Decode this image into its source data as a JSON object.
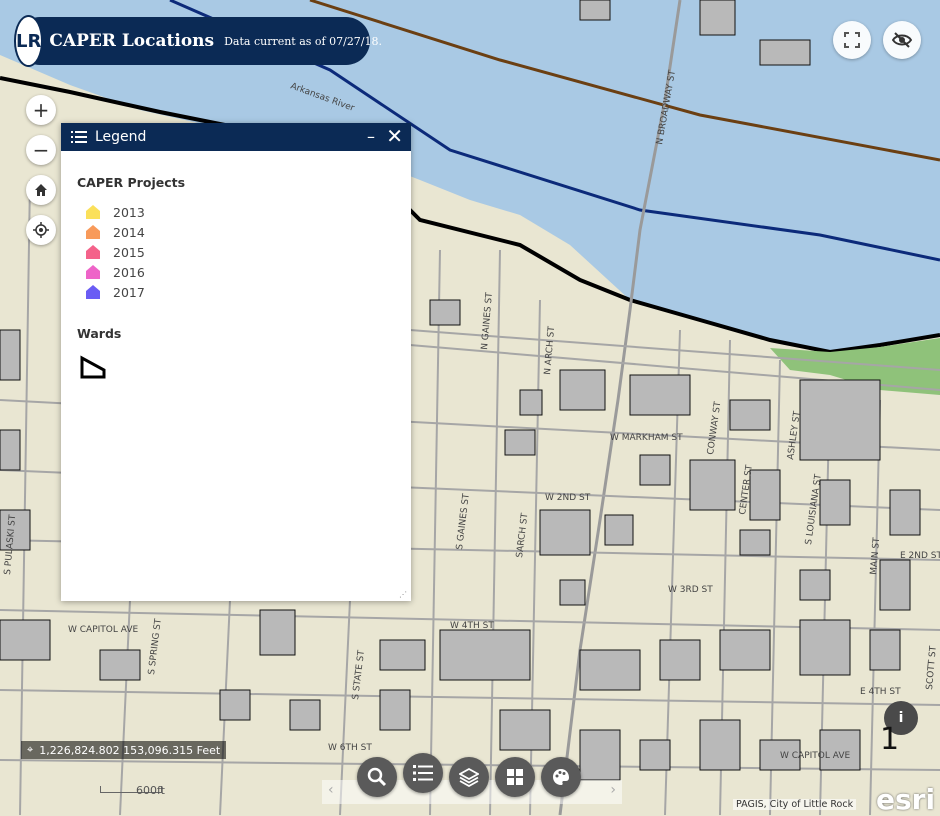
{
  "header": {
    "title": "CAPER Locations",
    "subtitle": "Data current as of 07/27/18.",
    "logo_text": "LR"
  },
  "map_controls": {
    "zoom_in": "+",
    "zoom_out": "−"
  },
  "legend": {
    "title": "Legend",
    "minimize": "–",
    "close": "✕",
    "layers": [
      {
        "title": "CAPER Projects",
        "items": [
          {
            "label": "2013",
            "color": "#fbe05a"
          },
          {
            "label": "2014",
            "color": "#f89a5a"
          },
          {
            "label": "2015",
            "color": "#f4628a"
          },
          {
            "label": "2016",
            "color": "#ee64c8"
          },
          {
            "label": "2017",
            "color": "#6a5cf4"
          }
        ]
      },
      {
        "title": "Wards",
        "items": []
      }
    ]
  },
  "coordinates": "1,226,824.802 153,096.315 Feet",
  "scale_label": "600ft",
  "attribution": "PAGIS, City of Little Rock",
  "esri_logo": "esri",
  "page_number": "1",
  "streets": [
    "Arkansas River",
    "N BROADWAY ST",
    "N GAINES ST",
    "N ARCH ST",
    "W MARKHAM ST",
    "CONWAY ST",
    "CENTER ST",
    "ASHLEY ST",
    "S LOUISIANA ST",
    "W 2ND ST",
    "S GAINES ST",
    "SARCH ST",
    "W 3RD ST",
    "MAIN ST",
    "E 2ND ST",
    "W 4TH ST",
    "W CAPITOL AVE",
    "S STATE ST",
    "S SPRING ST",
    "W 6TH ST",
    "W CAPITOL AVE",
    "E 4TH ST",
    "S PULASKI ST",
    "SCOTT ST"
  ],
  "colors": {
    "header_bg": "#0b2a55",
    "river": "#a9c9e4",
    "land": "#e9e6d2",
    "building": "#b9b9b9",
    "park": "#8fc27a"
  }
}
